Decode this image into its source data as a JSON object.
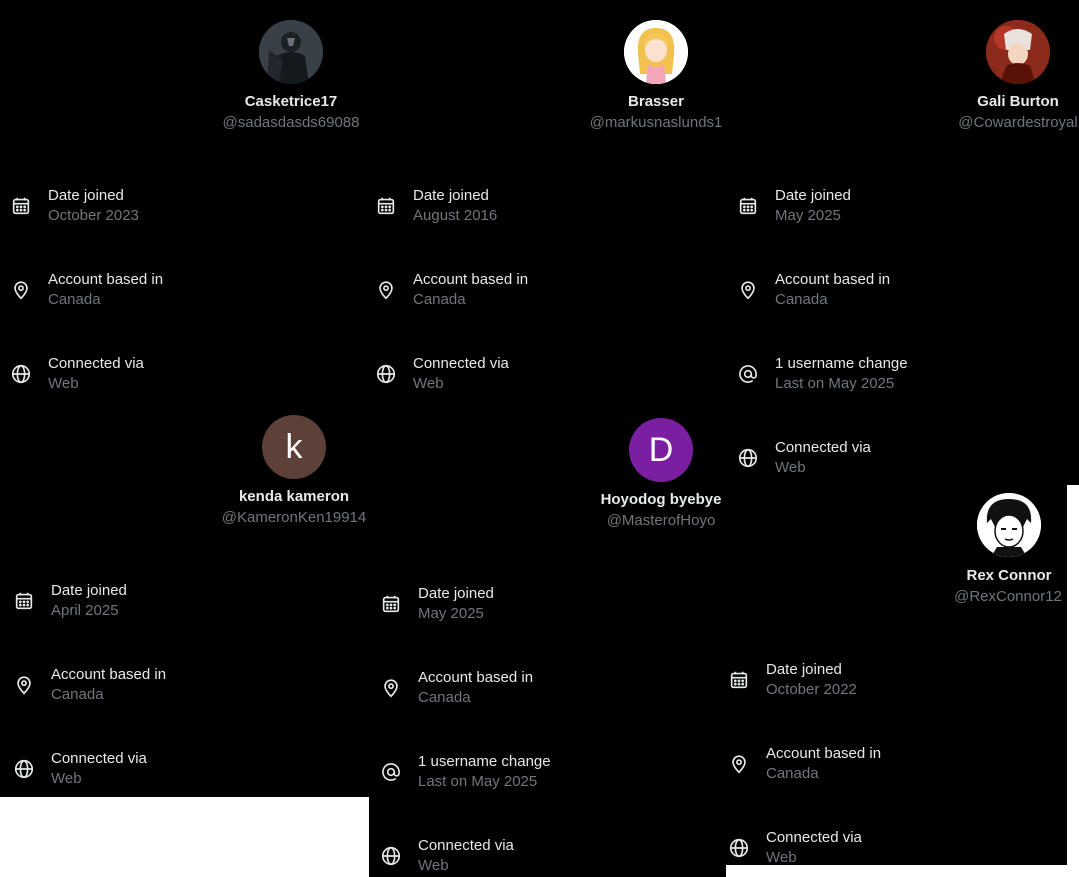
{
  "profiles": [
    {
      "name": "Casketrice17",
      "handle": "@sadasdasds69088",
      "avatar_icon": "knight-avatar-icon",
      "rows": [
        {
          "label": "Date joined",
          "value": "October 2023"
        },
        {
          "label": "Account based in",
          "value": "Canada"
        },
        {
          "label": "Connected via",
          "value": "Web"
        }
      ]
    },
    {
      "name": "Brasser",
      "handle": "@markusnaslunds1",
      "avatar_icon": "anime-girl-avatar-icon",
      "rows": [
        {
          "label": "Date joined",
          "value": "August 2016"
        },
        {
          "label": "Account based in",
          "value": "Canada"
        },
        {
          "label": "Connected via",
          "value": "Web"
        }
      ]
    },
    {
      "name": "Gali Burton",
      "handle": "@Cowardestroyal",
      "avatar_icon": "red-anime-avatar-icon",
      "rows": [
        {
          "label": "Date joined",
          "value": "May 2025"
        },
        {
          "label": "Account based in",
          "value": "Canada"
        },
        {
          "label": "1 username change",
          "value": "Last on May 2025"
        },
        {
          "label": "Connected via",
          "value": "Web"
        }
      ]
    },
    {
      "name": "kenda kameron",
      "handle": "@KameronKen19914",
      "avatar_letter": "k",
      "avatar_color": "#5d4037",
      "rows": [
        {
          "label": "Date joined",
          "value": "April 2025"
        },
        {
          "label": "Account based in",
          "value": "Canada"
        },
        {
          "label": "Connected via",
          "value": "Web"
        }
      ]
    },
    {
      "name": "Hoyodog byebye",
      "handle": "@MasterofHoyo",
      "avatar_letter": "D",
      "avatar_color": "#7b1fa2",
      "rows": [
        {
          "label": "Date joined",
          "value": "May 2025"
        },
        {
          "label": "Account based in",
          "value": "Canada"
        },
        {
          "label": "1 username change",
          "value": "Last on May 2025"
        },
        {
          "label": "Connected via",
          "value": "Web"
        }
      ]
    },
    {
      "name": "Rex Connor",
      "handle": "@RexConnor12",
      "avatar_icon": "manga-face-avatar-icon",
      "rows": [
        {
          "label": "Date joined",
          "value": "October 2022"
        },
        {
          "label": "Account based in",
          "value": "Canada"
        },
        {
          "label": "Connected via",
          "value": "Web"
        }
      ]
    }
  ],
  "row_icons": {
    "Date joined": "calendar-icon",
    "Account based in": "location-pin-icon",
    "Connected via": "globe-icon",
    "1 username change": "at-sign-icon"
  },
  "colors": {
    "background": "#000000",
    "primary_text": "#e7e9ea",
    "secondary_text": "#71767b"
  }
}
